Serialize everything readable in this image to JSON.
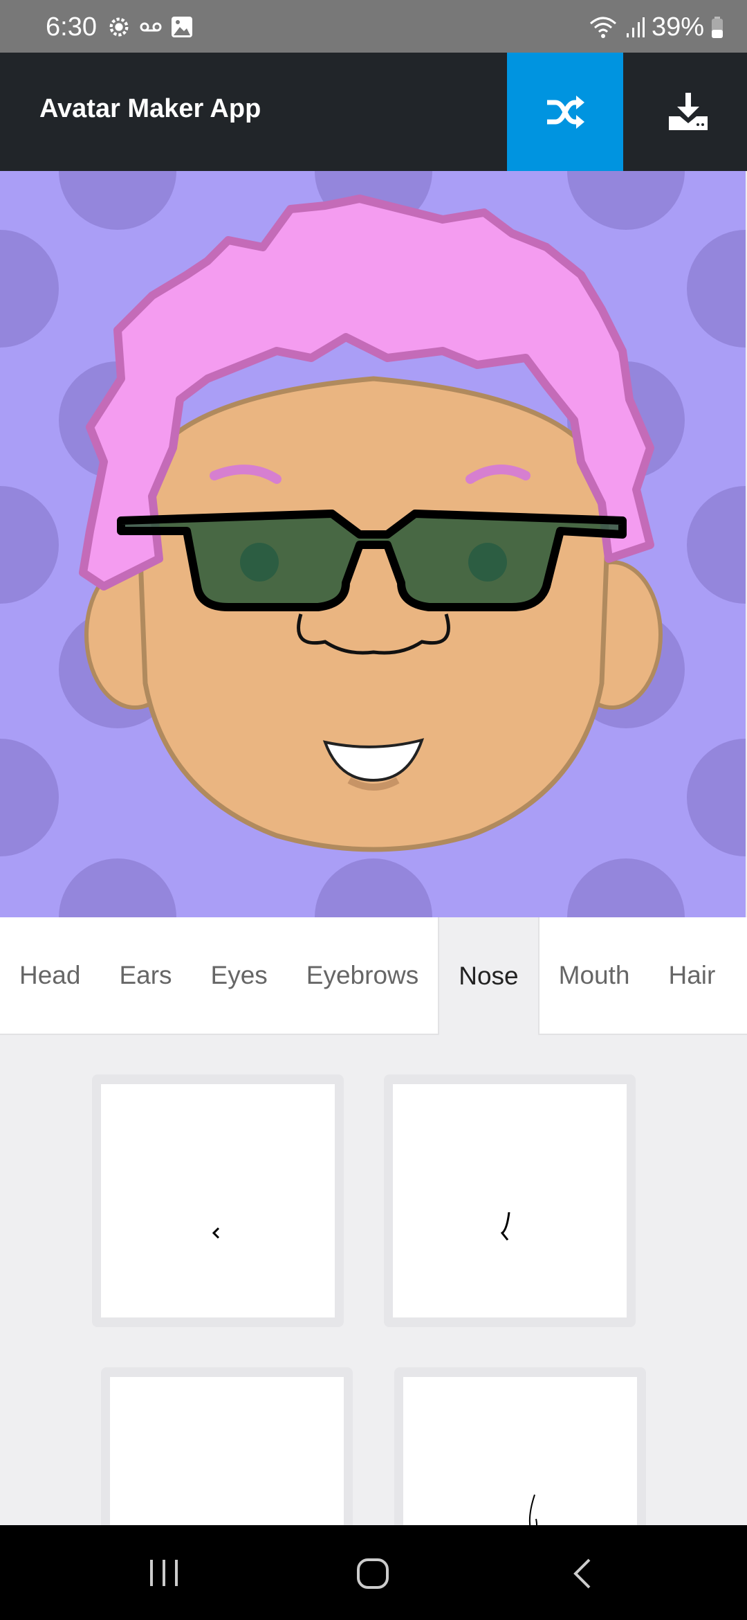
{
  "status_bar": {
    "time": "6:30",
    "battery": "39%",
    "icons": [
      "settings-gear-icon",
      "voicemail-icon",
      "image-icon",
      "wifi-icon",
      "signal-icon",
      "battery-icon"
    ]
  },
  "header": {
    "title": "Avatar Maker App",
    "shuffle_icon": "shuffle-icon",
    "download_icon": "download-icon",
    "accent": "#0094e0"
  },
  "avatar": {
    "background": "#aa9ef6",
    "hair_color": "#f49cf0",
    "skin_color": "#eab581"
  },
  "tabs": [
    {
      "label": "Head"
    },
    {
      "label": "Ears"
    },
    {
      "label": "Eyes"
    },
    {
      "label": "Eyebrows"
    },
    {
      "label": "Nose",
      "active": true
    },
    {
      "label": "Mouth"
    },
    {
      "label": "Hair"
    }
  ],
  "options": [
    "nose-option-1",
    "nose-option-2",
    "nose-option-3",
    "nose-option-4"
  ],
  "nav": {
    "recents": "recents-icon",
    "home": "home-icon",
    "back": "back-icon"
  }
}
